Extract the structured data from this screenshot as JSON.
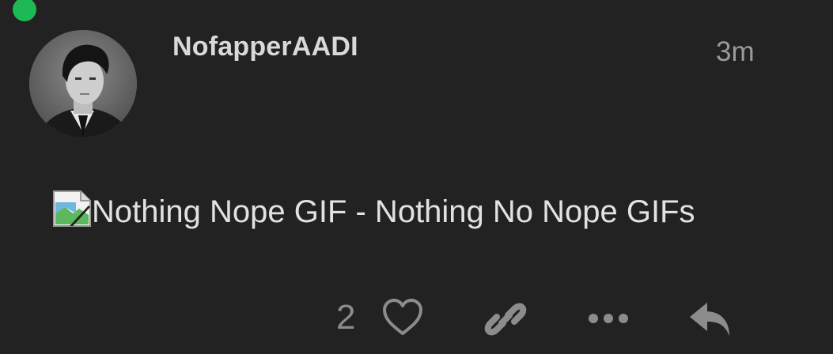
{
  "post": {
    "author": "NofapperAADI",
    "time": "3m",
    "content_alt": "Nothing Nope GIF - Nothing No Nope GIFs"
  },
  "actions": {
    "like_count": "2"
  },
  "colors": {
    "background": "#222222",
    "online_indicator": "#1db954",
    "text_primary": "#e2e2e2",
    "text_muted": "#8c8c8c"
  },
  "icons": {
    "presence": "online-status-icon",
    "image": "broken-image-icon",
    "like": "heart-icon",
    "link": "link-icon",
    "more": "ellipsis-icon",
    "reply": "reply-icon"
  }
}
